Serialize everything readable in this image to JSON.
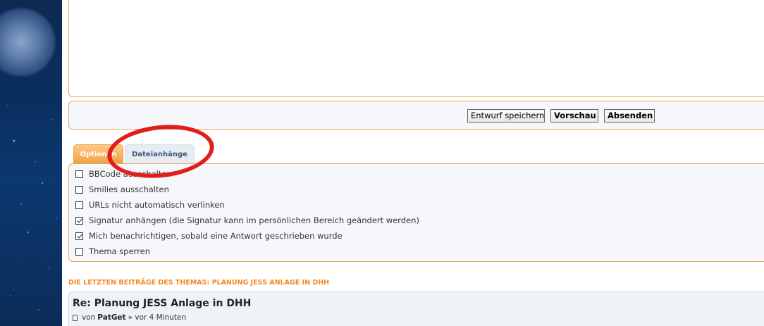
{
  "buttons": {
    "save_draft": "Entwurf speichern",
    "preview": "Vorschau",
    "submit": "Absenden"
  },
  "tabs": [
    {
      "label": "Optionen",
      "active": true
    },
    {
      "label": "Dateianhänge",
      "active": false
    }
  ],
  "options": [
    {
      "label": "BBCode ausschalten",
      "checked": false
    },
    {
      "label": "Smilies ausschalten",
      "checked": false
    },
    {
      "label": "URLs nicht automatisch verlinken",
      "checked": false
    },
    {
      "label": "Signatur anhängen (die Signatur kann im persönlichen Bereich geändert werden)",
      "checked": true
    },
    {
      "label": "Mich benachrichtigen, sobald eine Antwort geschrieben wurde",
      "checked": true
    },
    {
      "label": "Thema sperren",
      "checked": false
    }
  ],
  "recent": {
    "heading": "DIE LETZTEN BEITRÄGE DES THEMAS: PLANUNG JESS ANLAGE IN DHH",
    "post_title": "Re: Planung JESS Anlage in DHH",
    "by": "von",
    "author": "PatGet",
    "time": "» vor 4 Minuten"
  },
  "colors": {
    "accent": "#f08a1e",
    "panel_border": "#e7a55f",
    "annotation": "#e01e1e"
  }
}
